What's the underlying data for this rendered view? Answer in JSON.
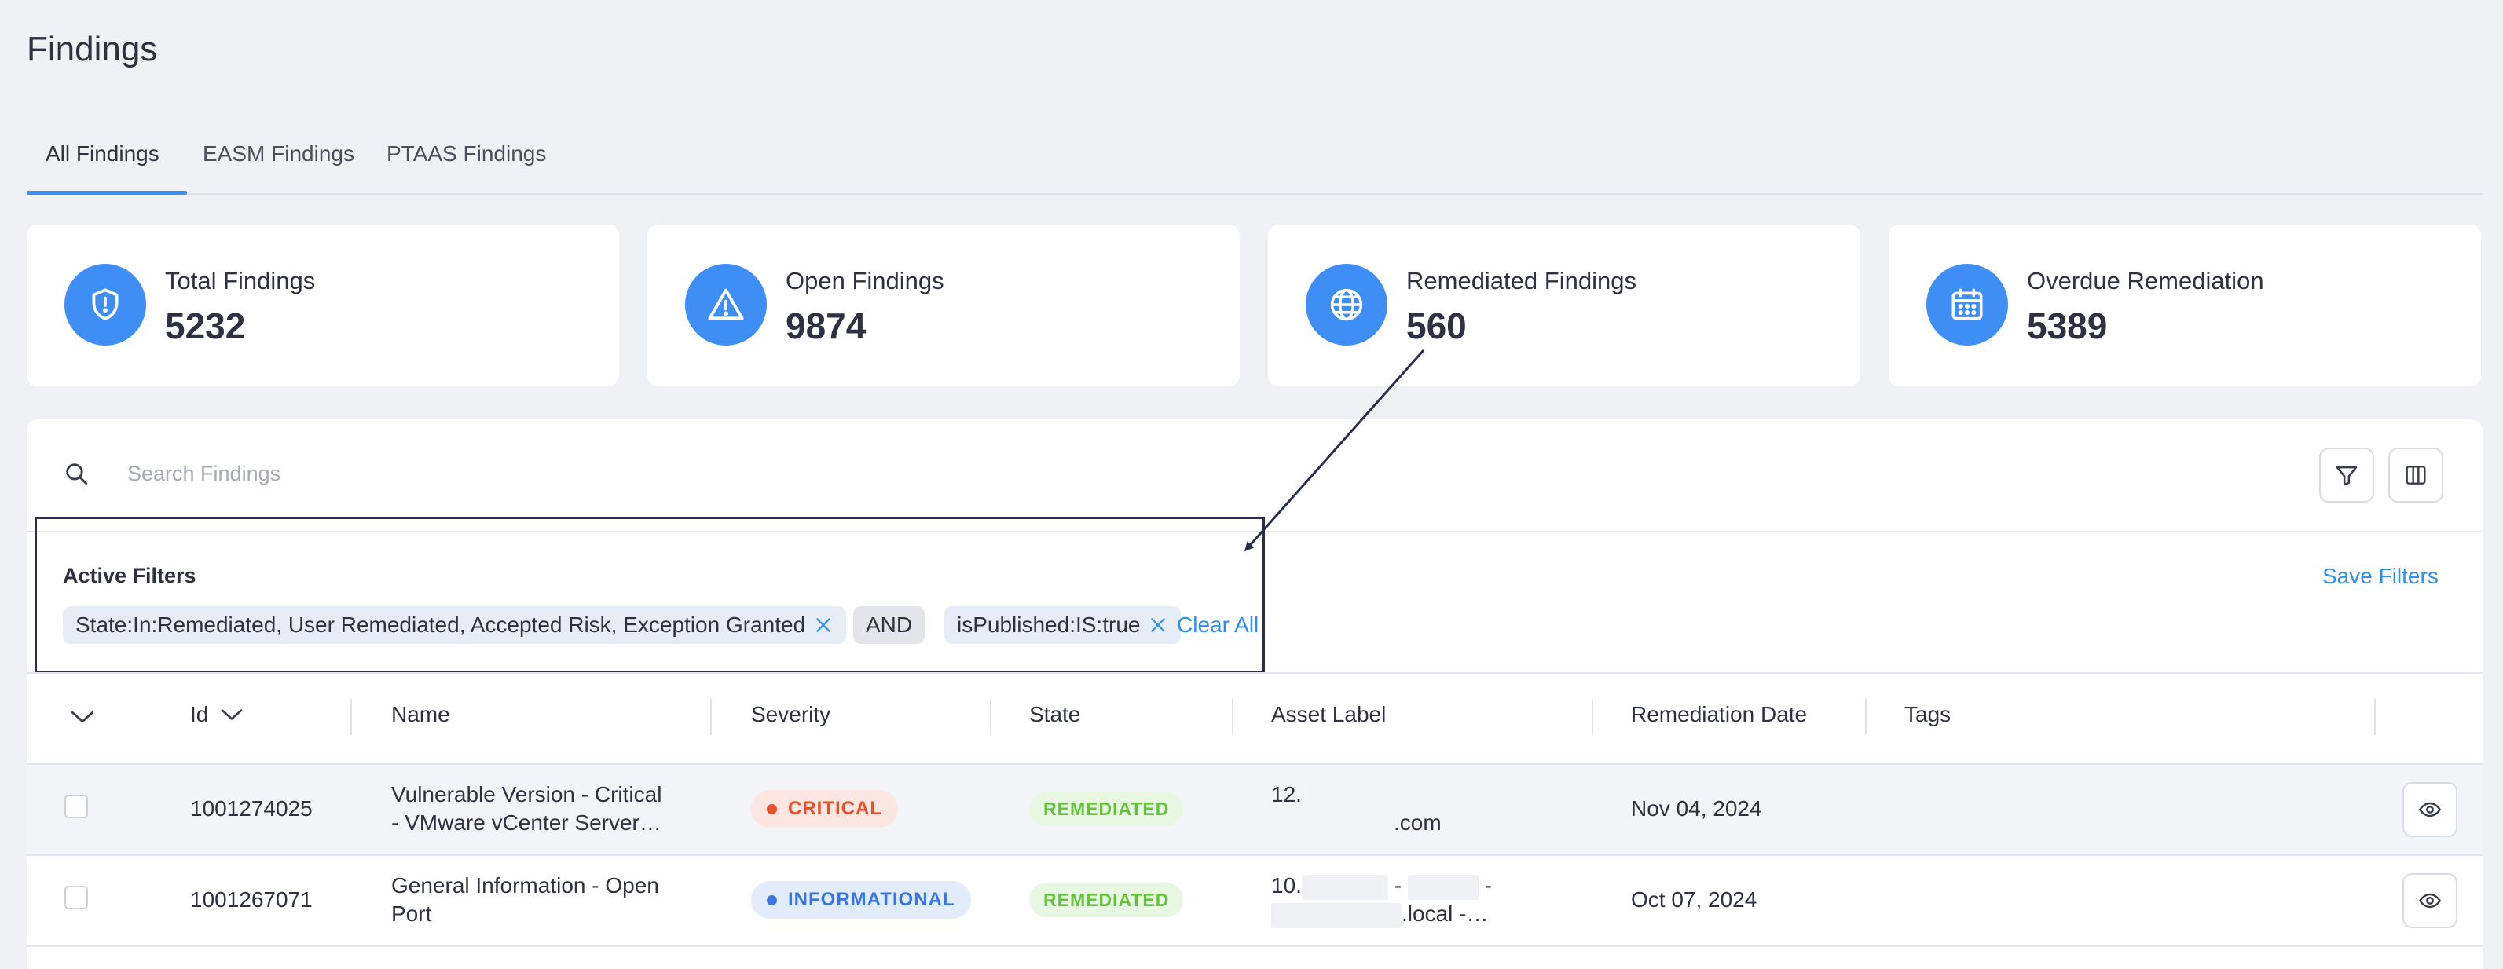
{
  "page": {
    "title": "Findings"
  },
  "tabs": [
    {
      "label": "All Findings"
    },
    {
      "label": "EASM Findings"
    },
    {
      "label": "PTAAS Findings"
    }
  ],
  "stats": [
    {
      "label": "Total Findings",
      "value": "5232",
      "icon": "shield-icon"
    },
    {
      "label": "Open Findings",
      "value": "9874",
      "icon": "warning-icon"
    },
    {
      "label": "Remediated Findings",
      "value": "560",
      "icon": "globe-icon"
    },
    {
      "label": "Overdue Remediation",
      "value": "5389",
      "icon": "calendar-icon"
    }
  ],
  "search": {
    "placeholder": "Search Findings",
    "value": ""
  },
  "filters": {
    "title": "Active Filters",
    "chips": [
      {
        "text": "State:In:Remediated, User Remediated, Accepted Risk, Exception Granted"
      },
      {
        "text": "AND"
      },
      {
        "text": "isPublished:IS:true"
      }
    ],
    "clear_all": "Clear All",
    "save": "Save Filters"
  },
  "table": {
    "columns": [
      "Id",
      "Name",
      "Severity",
      "State",
      "Asset Label",
      "Remediation Date",
      "Tags"
    ],
    "rows": [
      {
        "id": "1001274025",
        "name_line1": "Vulnerable Version - Critical",
        "name_line2": "- VMware vCenter Server…",
        "severity": "CRITICAL",
        "state": "REMEDIATED",
        "asset_line1_prefix": "12.",
        "asset_line2_suffix": ".com",
        "remediation_date": "Nov 04, 2024",
        "tags": ""
      },
      {
        "id": "1001267071",
        "name_line1": "General Information - Open",
        "name_line2": "Port",
        "severity": "INFORMATIONAL",
        "state": "REMEDIATED",
        "asset_line1_prefix": "10.",
        "asset_line1_sep1": "-",
        "asset_line1_sep2": "-",
        "asset_line2_suffix": ".local -…",
        "remediation_date": "Oct 07, 2024",
        "tags": ""
      }
    ]
  },
  "colors": {
    "accent": "#3f8ef5",
    "critical": "#e8502b",
    "informational": "#3b76e0",
    "remediated": "#66c23d"
  }
}
